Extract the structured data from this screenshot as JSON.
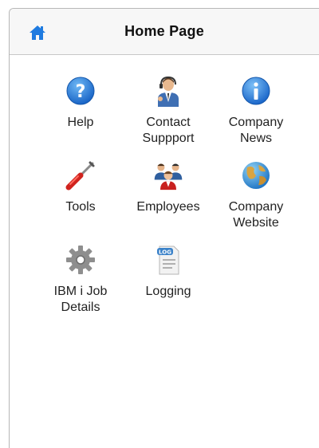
{
  "header": {
    "title": "Home Page",
    "home_icon": "home-icon"
  },
  "tiles": [
    {
      "label": "Help",
      "icon": "help-icon"
    },
    {
      "label": "Contact\nSuppport",
      "icon": "support-agent-icon"
    },
    {
      "label": "Company\nNews",
      "icon": "info-icon"
    },
    {
      "label": "Tools",
      "icon": "tools-icon"
    },
    {
      "label": "Employees",
      "icon": "employees-icon"
    },
    {
      "label": "Company\nWebsite",
      "icon": "globe-icon"
    },
    {
      "label": "IBM i Job\nDetails",
      "icon": "gear-icon"
    },
    {
      "label": "Logging",
      "icon": "log-document-icon"
    }
  ],
  "colors": {
    "accent": "#2b7fe0",
    "header_bg": "#f7f7f7"
  }
}
